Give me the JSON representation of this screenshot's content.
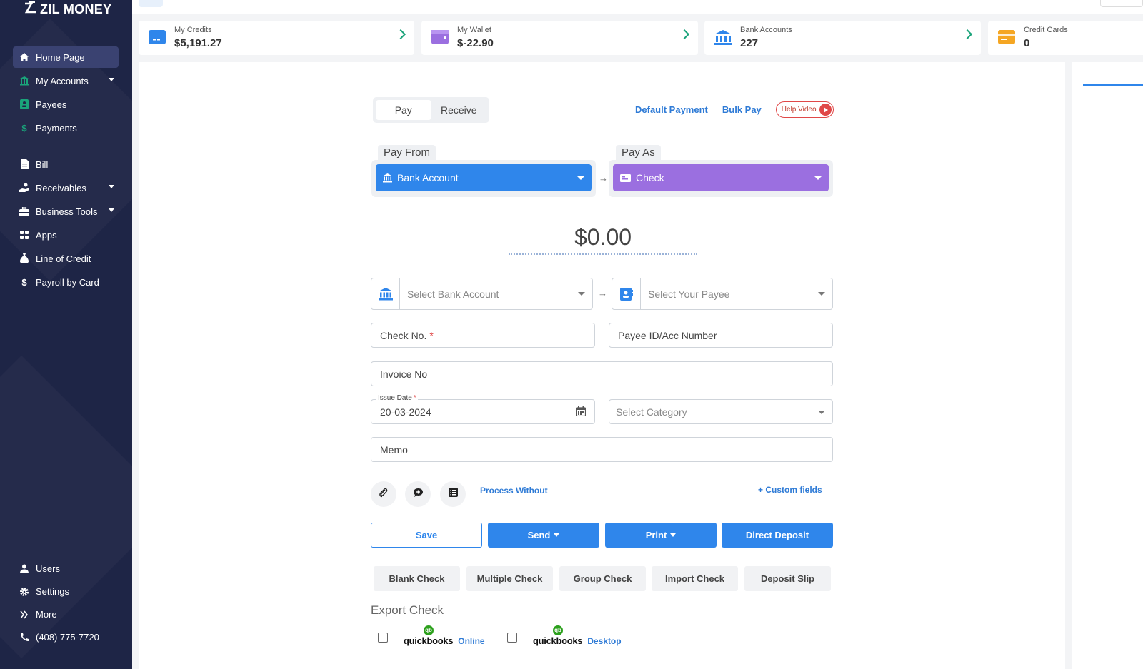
{
  "brand": {
    "name": "ZIL MONEY"
  },
  "sidebar": {
    "items": [
      {
        "label": "Home Page",
        "icon": "home-icon",
        "active": true
      },
      {
        "label": "My Accounts",
        "icon": "bank-icon",
        "dropdown": true
      },
      {
        "label": "Payees",
        "icon": "payee-icon"
      },
      {
        "label": "Payments",
        "icon": "dollar-icon"
      },
      {
        "label": "Bill",
        "icon": "bill-icon"
      },
      {
        "label": "Receivables",
        "icon": "receive-hand-icon",
        "dropdown": true
      },
      {
        "label": "Business Tools",
        "icon": "toolbox-icon",
        "dropdown": true
      },
      {
        "label": "Apps",
        "icon": "apps-grid-icon"
      },
      {
        "label": "Line of Credit",
        "icon": "money-bag-icon"
      },
      {
        "label": "Payroll by Card",
        "icon": "dollar-icon"
      }
    ],
    "bottom": [
      {
        "label": "Users",
        "icon": "user-icon"
      },
      {
        "label": "Settings",
        "icon": "gear-icon"
      },
      {
        "label": "More",
        "icon": "double-chevron-icon"
      },
      {
        "label": "(408) 775-7720",
        "icon": "phone-icon"
      }
    ]
  },
  "summary": [
    {
      "label": "My Credits",
      "value": "$5,191.27",
      "color": "#2f86eb"
    },
    {
      "label": "My Wallet",
      "value": "$-22.90",
      "color": "#9b6fe0"
    },
    {
      "label": "Bank Accounts",
      "value": "227",
      "color": "#2f86eb"
    },
    {
      "label": "Credit Cards",
      "value": "0",
      "color": "#f5a623"
    }
  ],
  "form": {
    "tabs": [
      "Pay",
      "Receive"
    ],
    "links": {
      "default_payment": "Default Payment",
      "bulk_pay": "Bulk Pay",
      "help_video": "Help Video"
    },
    "pay_from": {
      "label": "Pay From",
      "value": "Bank Account",
      "color": "#2f86eb"
    },
    "pay_as": {
      "label": "Pay As",
      "value": "Check",
      "color": "#9b6fe0"
    },
    "amount": "$0.00",
    "bank_select": {
      "placeholder": "Select Bank Account"
    },
    "payee_select": {
      "placeholder": "Select Your Payee"
    },
    "check_no": "Check No.",
    "payee_id": "Payee ID/Acc Number",
    "invoice_no": "Invoice No",
    "issue_date": {
      "label": "Issue Date",
      "value": "20-03-2024"
    },
    "category": {
      "placeholder": "Select Category"
    },
    "memo": "Memo",
    "process_without": "Process Without",
    "custom_fields": "+ Custom fields",
    "actions": {
      "save": "Save",
      "send": "Send",
      "print": "Print",
      "direct_deposit": "Direct Deposit"
    },
    "check_types": [
      "Blank Check",
      "Multiple Check",
      "Group Check",
      "Import Check",
      "Deposit Slip"
    ],
    "export": {
      "title": "Export Check",
      "options": [
        {
          "brand": "quickbooks",
          "kind": "Online"
        },
        {
          "brand": "quickbooks",
          "kind": "Desktop"
        }
      ]
    }
  },
  "colors": {
    "sidebar_bg": "#1e2546",
    "accent": "#2f86eb",
    "purple": "#9b6fe0"
  }
}
